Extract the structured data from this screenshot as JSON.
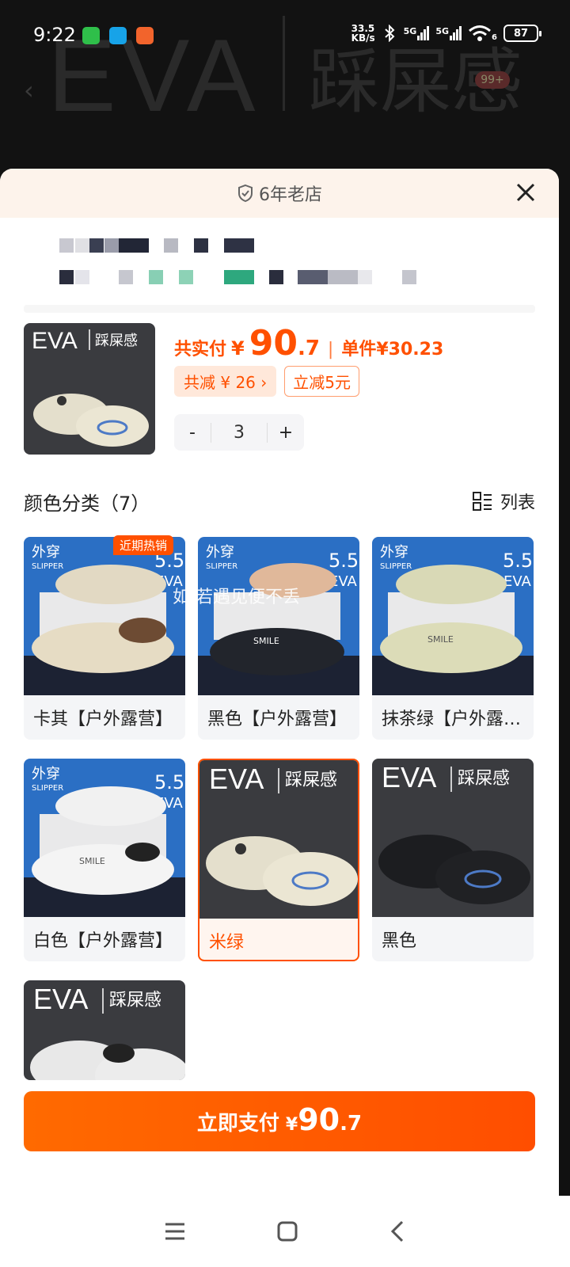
{
  "status_bar": {
    "time": "9:22",
    "net_speed_value": "33.5",
    "net_speed_unit": "KB/s",
    "sim1": "5G",
    "sim2": "5G",
    "wifi_sub": "6",
    "battery": "87"
  },
  "backdrop": {
    "eva": "EVA",
    "brand_cn": "踩屎感",
    "badge": "99+"
  },
  "sheet": {
    "header_title": "6年老店"
  },
  "summary": {
    "total_label": "共实付",
    "currency": "¥",
    "total_int": "90",
    "total_dec": ".7",
    "separator": "|",
    "unit_label": "单件",
    "unit_price": "¥30.23",
    "discount_tag": "共减 ¥ 26 ›",
    "instant_tag": "立减5元",
    "quantity": "3",
    "minus": "-",
    "plus": "+"
  },
  "options": {
    "title": "颜色分类（7）",
    "list_label": "列表",
    "hot_badge": "近期热销",
    "watermark": "如.若遇见便不丢",
    "items": [
      {
        "label": "卡其【户外露营】"
      },
      {
        "label": "黑色【户外露营】"
      },
      {
        "label": "抹茶绿【户外露营】"
      },
      {
        "label": "白色【户外露营】"
      },
      {
        "label": "米绿"
      },
      {
        "label": "黑色"
      },
      {
        "label": ""
      }
    ],
    "card_text": {
      "outdoor": "外穿",
      "slipper": "SLIPPER",
      "thickness": "5.5",
      "eva": "EVA",
      "brand_cn": "踩屎感",
      "smile": "SMILE"
    }
  },
  "pay_button": {
    "label": "立即支付",
    "currency": "¥",
    "int": "90",
    "dec": ".7"
  },
  "colors": {
    "accent": "#ff5000",
    "header_bg": "#fdf3eb"
  }
}
